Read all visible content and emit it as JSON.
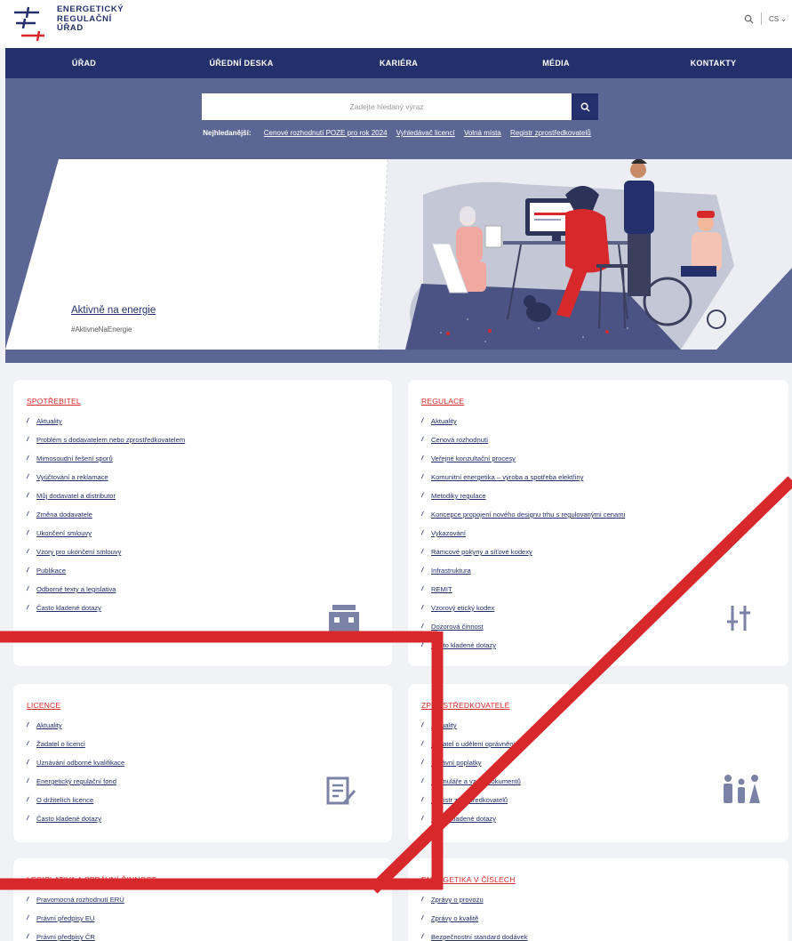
{
  "header": {
    "logo_lines": [
      "ENERGETICKÝ",
      "REGULAČNÍ",
      "ÚŘAD"
    ],
    "lang": "CS"
  },
  "nav": [
    "ÚŘAD",
    "ÚŘEDNÍ DESKA",
    "KARIÉRA",
    "MÉDIA",
    "KONTAKTY"
  ],
  "search": {
    "placeholder": "Zadejte hledaný výraz",
    "popular_label": "Nejhledanější:",
    "popular_links": [
      "Cenové rozhodnutí POZE pro rok 2024",
      "Vyhledávač licencí",
      "Volná místa",
      "Registr zprostředkovatelů"
    ]
  },
  "hero": {
    "title": "Aktivně na energie",
    "hashtag": "#AktivneNaEnergie"
  },
  "colors": {
    "navy": "#23306b",
    "accent": "#d7282b",
    "band": "#5c6694"
  },
  "cards": [
    {
      "title": "SPOTŘEBITEL",
      "icon": "house-icon",
      "items": [
        "Aktuality",
        "Problém s dodavatelem nebo zprostředkovatelem",
        "Mimosoudní řešení sporů",
        "Vyúčtování a reklamace",
        "Můj dodavatel a distributor",
        "Změna dodavatele",
        "Ukončení smlouvy",
        "Vzory pro ukončení smlouvy",
        "Publikace",
        "Odborné texty a legislativa",
        "Často kladené dotazy"
      ]
    },
    {
      "title": "REGULACE",
      "icon": "sliders-icon",
      "items": [
        "Aktuality",
        "Cenová rozhodnutí",
        "Veřejné konzultační procesy",
        "Komunitní energetika – výroba a spotřeba elektřiny",
        "Metodiky regulace",
        "Koncepce propojení nového designu trhu s regulovanými cenami",
        "Vykazování",
        "Rámcové pokyny a síťové kodexy",
        "Infrastruktura",
        "REMIT",
        "Vzorový etický kodex",
        "Dozorová činnost",
        "Často kladené dotazy"
      ]
    },
    {
      "title": "LICENCE",
      "icon": "document-edit-icon",
      "items": [
        "Aktuality",
        "Žadatel o licenci",
        "Uznávání odborné kvalifikace",
        "Energetický regulační fond",
        "O držitelích licence",
        "Často kladené dotazy"
      ]
    },
    {
      "title": "ZPROSTŘEDKOVATELÉ",
      "icon": "people-icon",
      "items": [
        "Aktuality",
        "Žadatel o udělení oprávnění",
        "Správní poplatky",
        "Formuláře a vzory dokumentů",
        "Registr zprostředkovatelů",
        "Často kladené dotazy"
      ]
    },
    {
      "title": "LEGISLATIVA A SPRÁVNÍ ČINNOST",
      "icon": "",
      "items": [
        "Pravomocná rozhodnutí ERÚ",
        "Právní předpisy EU",
        "Právní předpisy ČR"
      ]
    },
    {
      "title": "ENERGETIKA V ČÍSLECH",
      "icon": "",
      "items": [
        "Zprávy o provozu",
        "Zprávy o kvalitě",
        "Bezpečnostní standard dodávek"
      ]
    }
  ]
}
